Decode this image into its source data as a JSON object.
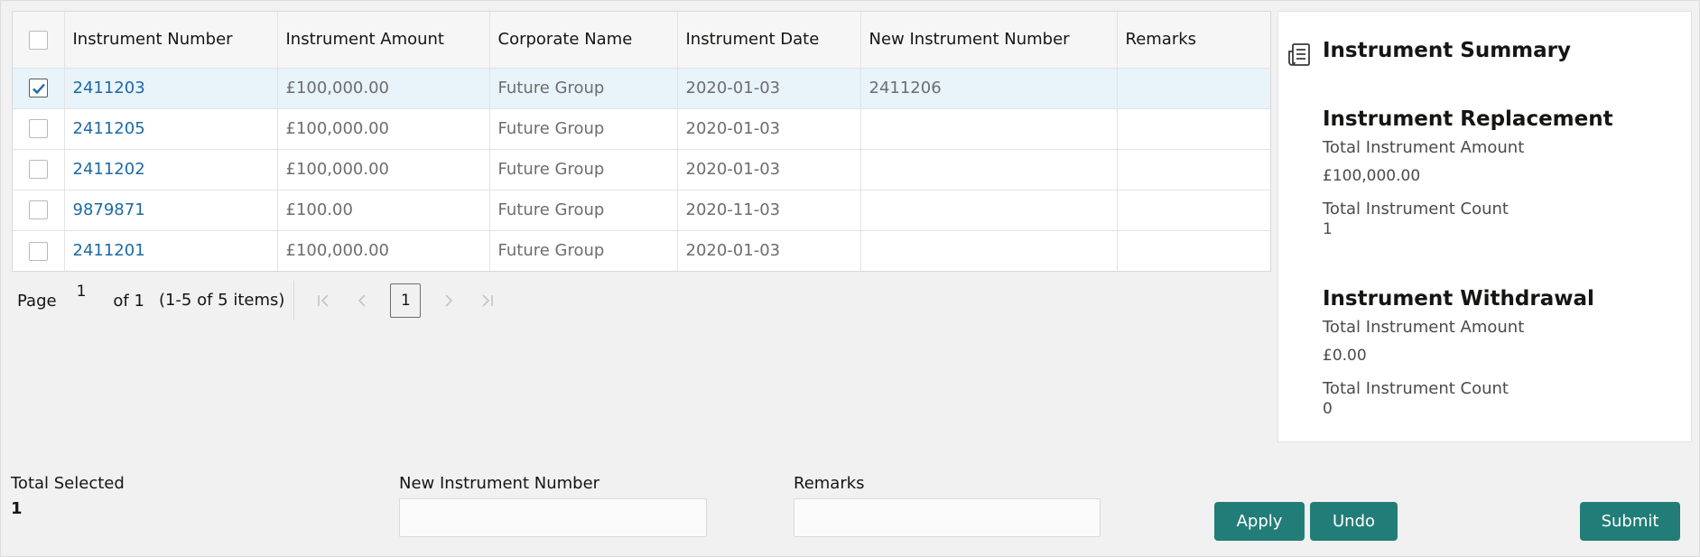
{
  "table": {
    "columns": [
      "Instrument Number",
      "Instrument Amount",
      "Corporate Name",
      "Instrument Date",
      "New Instrument Number",
      "Remarks"
    ],
    "rows": [
      {
        "selected": true,
        "instrument_number": "2411203",
        "amount": "£100,000.00",
        "corporate": "Future Group",
        "date": "2020-01-03",
        "new_number": "2411206",
        "remarks": ""
      },
      {
        "selected": false,
        "instrument_number": "2411205",
        "amount": "£100,000.00",
        "corporate": "Future Group",
        "date": "2020-01-03",
        "new_number": "",
        "remarks": ""
      },
      {
        "selected": false,
        "instrument_number": "2411202",
        "amount": "£100,000.00",
        "corporate": "Future Group",
        "date": "2020-01-03",
        "new_number": "",
        "remarks": ""
      },
      {
        "selected": false,
        "instrument_number": "9879871",
        "amount": "£100.00",
        "corporate": "Future Group",
        "date": "2020-11-03",
        "new_number": "",
        "remarks": ""
      },
      {
        "selected": false,
        "instrument_number": "2411201",
        "amount": "£100,000.00",
        "corporate": "Future Group",
        "date": "2020-01-03",
        "new_number": "",
        "remarks": ""
      }
    ]
  },
  "pager": {
    "label": "Page",
    "current": "1",
    "of": "of 1",
    "range": "(1-5 of 5 items)",
    "page_button": "1"
  },
  "summary": {
    "title": "Instrument Summary",
    "icon": "document-list-icon",
    "replacement": {
      "title": "Instrument Replacement",
      "amount_label": "Total Instrument Amount",
      "amount": "£100,000.00",
      "count_label": "Total Instrument Count",
      "count": "1"
    },
    "withdrawal": {
      "title": "Instrument Withdrawal",
      "amount_label": "Total Instrument Amount",
      "amount": "£0.00",
      "count_label": "Total Instrument Count",
      "count": "0"
    }
  },
  "form": {
    "total_selected_label": "Total Selected",
    "total_selected": "1",
    "new_number_label": "New Instrument Number",
    "new_number_value": "",
    "remarks_label": "Remarks",
    "remarks_value": "",
    "apply": "Apply",
    "undo": "Undo",
    "submit": "Submit"
  },
  "colors": {
    "accent": "#227d78",
    "link": "#1c6aa3",
    "selected_row": "#e8f3fa"
  }
}
